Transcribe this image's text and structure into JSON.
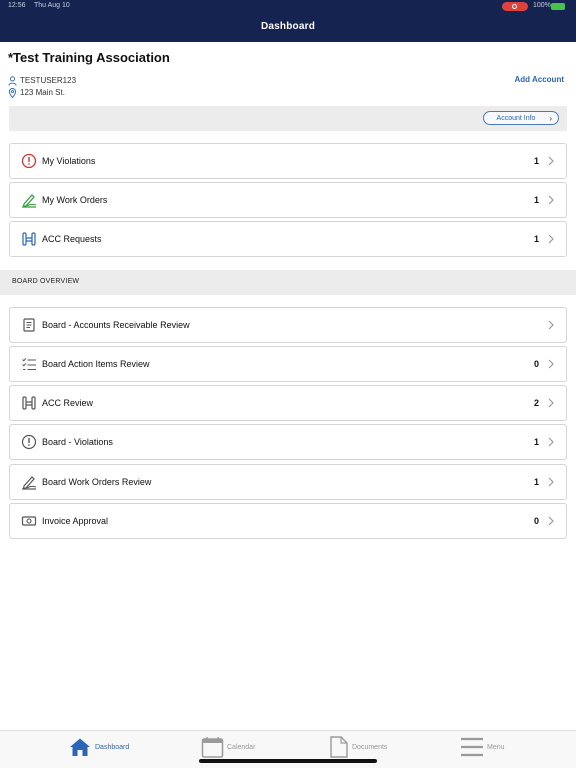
{
  "status_bar": {
    "time": "12:56",
    "date": "Thu Aug 10",
    "battery": "100%"
  },
  "nav": {
    "title": "Dashboard"
  },
  "account": {
    "name": "*Test Training Association",
    "user": "TESTUSER123",
    "address": "123 Main St.",
    "add_account_label": "Add Account",
    "account_info_label": "Account Info"
  },
  "my_items": [
    {
      "label": "My Violations",
      "count": "1",
      "icon": "violation-icon"
    },
    {
      "label": "My Work Orders",
      "count": "1",
      "icon": "work-order-icon"
    },
    {
      "label": "ACC Requests",
      "count": "1",
      "icon": "acc-request-icon"
    }
  ],
  "board_section_label": "BOARD OVERVIEW",
  "board_items": [
    {
      "label": "Board - Accounts Receivable Review",
      "count": "",
      "icon": "ledger-icon"
    },
    {
      "label": "Board Action Items Review",
      "count": "0",
      "icon": "checklist-icon"
    },
    {
      "label": "ACC Review",
      "count": "2",
      "icon": "acc-review-icon"
    },
    {
      "label": "Board - Violations",
      "count": "1",
      "icon": "violation-icon"
    },
    {
      "label": "Board Work Orders Review",
      "count": "1",
      "icon": "work-order-icon"
    },
    {
      "label": "Invoice Approval",
      "count": "0",
      "icon": "invoice-icon"
    }
  ],
  "tabs": [
    {
      "label": "Dashboard",
      "icon": "home-icon",
      "active": true
    },
    {
      "label": "Calendar",
      "icon": "calendar-icon",
      "active": false
    },
    {
      "label": "Documents",
      "icon": "document-icon",
      "active": false
    },
    {
      "label": "Menu",
      "icon": "menu-icon",
      "active": false
    }
  ],
  "colors": {
    "nav_bg": "#142350",
    "accent": "#2a66b5",
    "alert_red": "#d0342c",
    "section_bg": "#ececec"
  }
}
